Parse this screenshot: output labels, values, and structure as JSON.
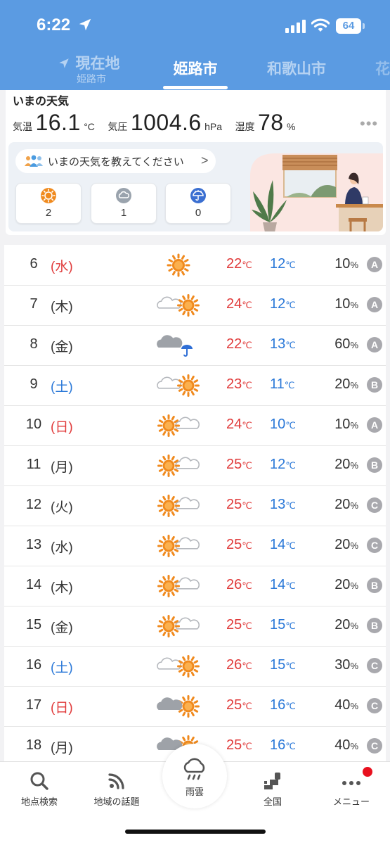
{
  "status_bar": {
    "time": "6:22",
    "battery": "64"
  },
  "tabs": [
    {
      "label": "現在地",
      "sub": "姫路市"
    },
    {
      "label": "姫路市"
    },
    {
      "label": "和歌山市"
    },
    {
      "label": "花"
    }
  ],
  "now": {
    "title": "いまの天気",
    "temp_label": "気温",
    "temp_value": "16.1",
    "temp_unit": "°C",
    "pressure_label": "気圧",
    "pressure_value": "1004.6",
    "pressure_unit": "hPa",
    "humidity_label": "湿度",
    "humidity_value": "78",
    "humidity_unit": "%",
    "more": "•••",
    "report_prompt": "いまの天気を教えてください",
    "report_chevron": ">",
    "votes": [
      {
        "icon": "sunny-icon",
        "count": "2"
      },
      {
        "icon": "cloudy-icon",
        "count": "1"
      },
      {
        "icon": "rain-icon",
        "count": "0"
      }
    ]
  },
  "temp_unit": "℃",
  "pop_unit": "%",
  "colors": {
    "header": "#5b9be2",
    "max": "#e03a3a",
    "min": "#2a78d8",
    "sun": "#f08a1e"
  },
  "forecast": [
    {
      "day": "6",
      "weekday": "(水)",
      "wd_type": "sun-red",
      "icon": "sunny",
      "max": "22",
      "min": "12",
      "pop": "10",
      "rel": "A"
    },
    {
      "day": "7",
      "weekday": "(木)",
      "wd_type": "weekday",
      "icon": "cloud-then-sun",
      "max": "24",
      "min": "12",
      "pop": "10",
      "rel": "A"
    },
    {
      "day": "8",
      "weekday": "(金)",
      "wd_type": "weekday",
      "icon": "cloud-rain",
      "max": "22",
      "min": "13",
      "pop": "60",
      "rel": "A"
    },
    {
      "day": "9",
      "weekday": "(土)",
      "wd_type": "sat",
      "icon": "cloud-then-sun",
      "max": "23",
      "min": "11",
      "pop": "20",
      "rel": "B"
    },
    {
      "day": "10",
      "weekday": "(日)",
      "wd_type": "sun",
      "icon": "sun-then-cloud",
      "max": "24",
      "min": "10",
      "pop": "10",
      "rel": "A"
    },
    {
      "day": "11",
      "weekday": "(月)",
      "wd_type": "weekday",
      "icon": "sun-then-cloud",
      "max": "25",
      "min": "12",
      "pop": "20",
      "rel": "B"
    },
    {
      "day": "12",
      "weekday": "(火)",
      "wd_type": "weekday",
      "icon": "sun-then-cloud",
      "max": "25",
      "min": "13",
      "pop": "20",
      "rel": "C"
    },
    {
      "day": "13",
      "weekday": "(水)",
      "wd_type": "weekday",
      "icon": "sun-then-cloud",
      "max": "25",
      "min": "14",
      "pop": "20",
      "rel": "C"
    },
    {
      "day": "14",
      "weekday": "(木)",
      "wd_type": "weekday",
      "icon": "sun-then-cloud",
      "max": "26",
      "min": "14",
      "pop": "20",
      "rel": "B"
    },
    {
      "day": "15",
      "weekday": "(金)",
      "wd_type": "weekday",
      "icon": "sun-then-cloud",
      "max": "25",
      "min": "15",
      "pop": "20",
      "rel": "B"
    },
    {
      "day": "16",
      "weekday": "(土)",
      "wd_type": "sat",
      "icon": "cloud-then-sun",
      "max": "26",
      "min": "15",
      "pop": "30",
      "rel": "C"
    },
    {
      "day": "17",
      "weekday": "(日)",
      "wd_type": "sun",
      "icon": "dark-cloud-sun",
      "max": "25",
      "min": "16",
      "pop": "40",
      "rel": "C"
    },
    {
      "day": "18",
      "weekday": "(月)",
      "wd_type": "weekday",
      "icon": "dark-cloud-sun",
      "max": "25",
      "min": "16",
      "pop": "40",
      "rel": "C"
    }
  ],
  "tabbar": {
    "search": "地点検索",
    "topics": "地域の話題",
    "rain": "雨雲",
    "country": "全国",
    "menu": "メニュー"
  }
}
